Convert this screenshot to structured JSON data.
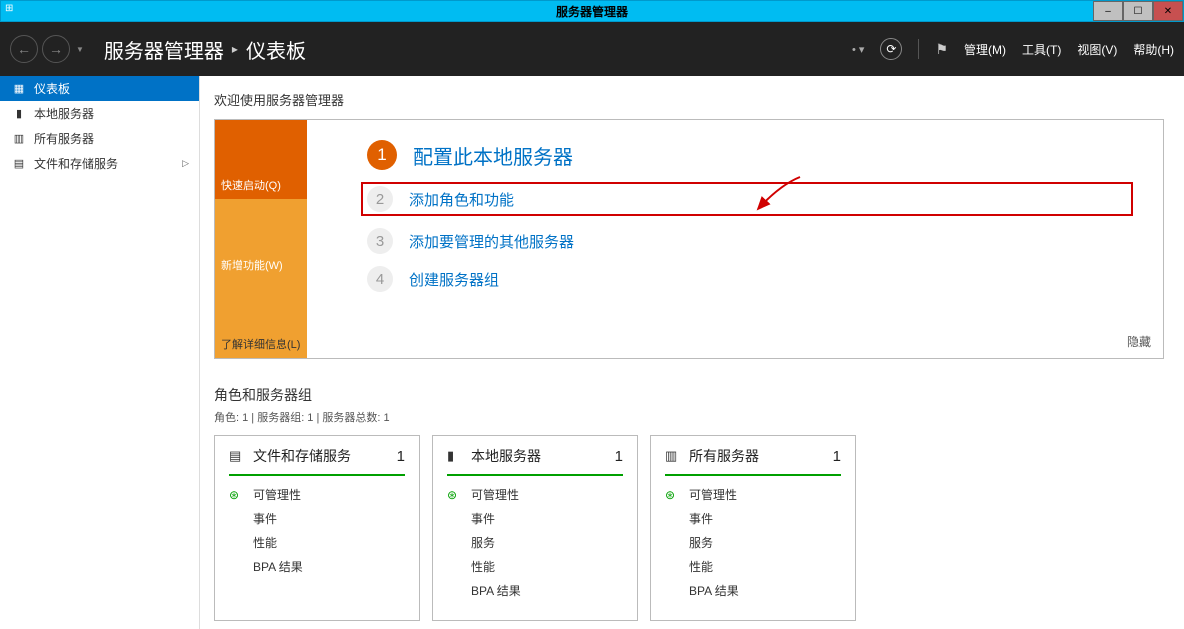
{
  "window": {
    "title": "服务器管理器",
    "controls": {
      "min": "–",
      "max": "☐",
      "close": "✕"
    }
  },
  "header": {
    "app_title": "服务器管理器",
    "breadcrumb_sep": "▸",
    "current_page": "仪表板",
    "menu": {
      "manage": "管理(M)",
      "tools": "工具(T)",
      "view": "视图(V)",
      "help": "帮助(H)"
    },
    "refresh_dropdown": "▾"
  },
  "sidebar": {
    "items": [
      {
        "icon": "▦",
        "label": "仪表板"
      },
      {
        "icon": "▮",
        "label": "本地服务器"
      },
      {
        "icon": "▥",
        "label": "所有服务器"
      },
      {
        "icon": "▤",
        "label": "文件和存储服务",
        "expandable": true,
        "expand": "▷"
      }
    ]
  },
  "welcome": {
    "title": "欢迎使用服务器管理器",
    "tabs": {
      "quickstart": "快速启动(Q)",
      "whatsnew": "新增功能(W)",
      "learnmore": "了解详细信息(L)"
    },
    "steps": [
      {
        "num": "1",
        "text": "配置此本地服务器"
      },
      {
        "num": "2",
        "text": "添加角色和功能"
      },
      {
        "num": "3",
        "text": "添加要管理的其他服务器"
      },
      {
        "num": "4",
        "text": "创建服务器组"
      }
    ],
    "hide": "隐藏"
  },
  "groups": {
    "title": "角色和服务器组",
    "subtitle": "角色: 1 | 服务器组: 1 | 服务器总数: 1",
    "cards": [
      {
        "icon": "▤",
        "title": "文件和存储服务",
        "count": "1",
        "rows": [
          "可管理性",
          "事件",
          "性能",
          "BPA 结果"
        ]
      },
      {
        "icon": "▮",
        "title": "本地服务器",
        "count": "1",
        "rows": [
          "可管理性",
          "事件",
          "服务",
          "性能",
          "BPA 结果"
        ]
      },
      {
        "icon": "▥",
        "title": "所有服务器",
        "count": "1",
        "rows": [
          "可管理性",
          "事件",
          "服务",
          "性能",
          "BPA 结果"
        ]
      }
    ]
  }
}
